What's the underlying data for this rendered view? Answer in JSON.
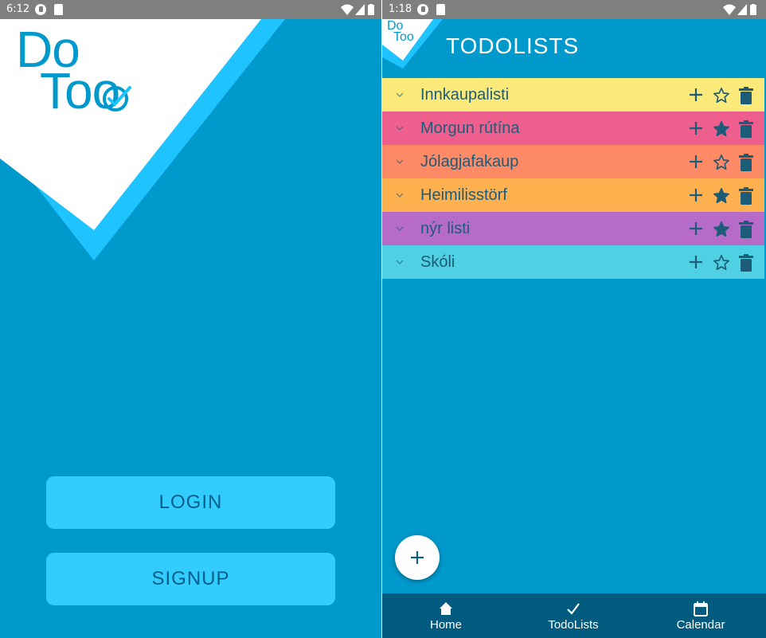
{
  "left_screen": {
    "status_time": "6:12",
    "logo": {
      "line1": "Do",
      "line2": "Too"
    },
    "login_label": "LOGIN",
    "signup_label": "SIGNUP"
  },
  "right_screen": {
    "status_time": "1:18",
    "logo": {
      "line1": "Do",
      "line2": "Too"
    },
    "title": "TODOLISTS",
    "lists": [
      {
        "name": "Innkaupalisti",
        "color": "#fbea7a",
        "favorite": false
      },
      {
        "name": "Morgun rútína",
        "color": "#ee5f8e",
        "favorite": true
      },
      {
        "name": "Jólagjafakaup",
        "color": "#ff8a65",
        "favorite": false
      },
      {
        "name": "Heimilisstörf",
        "color": "#ffb04f",
        "favorite": true
      },
      {
        "name": "nýr listi",
        "color": "#b76bc9",
        "favorite": true
      },
      {
        "name": "Skóli",
        "color": "#4fd0e3",
        "favorite": false
      }
    ],
    "fab_icon": "plus-icon",
    "nav": [
      {
        "label": "Home",
        "icon": "home-icon"
      },
      {
        "label": "TodoLists",
        "icon": "check-icon"
      },
      {
        "label": "Calendar",
        "icon": "calendar-icon"
      }
    ]
  },
  "colors": {
    "background": "#0099cc",
    "button": "#33ccff",
    "status_bar": "#7f7f7f",
    "bottom_nav": "#005b7f",
    "logo_accent": "#1ec3ff"
  }
}
